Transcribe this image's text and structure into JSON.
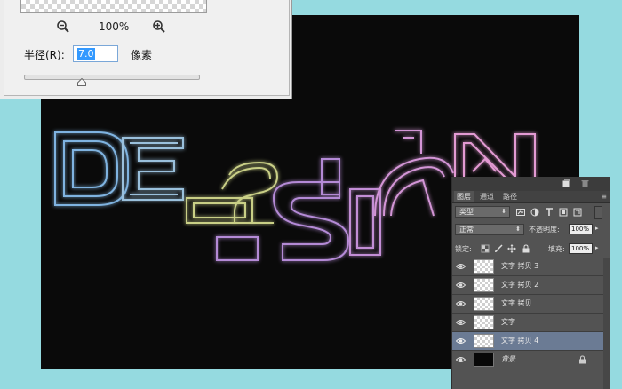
{
  "dialog": {
    "zoom_level": "100%",
    "radius_label": "半径(R):",
    "radius_value": "7.0",
    "radius_unit": "像素",
    "slider_position": 0.33
  },
  "canvas": {
    "artwork_text": "DESIGN",
    "glow_colors": [
      "#6ea6d8",
      "#c9d089",
      "#b98ad8",
      "#e39ad6"
    ]
  },
  "layers_panel": {
    "tabs": [
      {
        "label": "图层",
        "active": true
      },
      {
        "label": "通道",
        "active": false
      },
      {
        "label": "路径",
        "active": false
      }
    ],
    "panel_menu_icon": "≡",
    "filter_kind": "类型",
    "blend_mode": "正常",
    "opacity_label": "不透明度:",
    "opacity_value": "100%",
    "lock_label": "锁定:",
    "fill_label": "填充:",
    "fill_value": "100%",
    "layers": [
      {
        "name": "文字 拷贝 3",
        "visible": true,
        "selected": false,
        "thumb": "transparent"
      },
      {
        "name": "文字 拷贝 2",
        "visible": true,
        "selected": false,
        "thumb": "transparent"
      },
      {
        "name": "文字 拷贝",
        "visible": true,
        "selected": false,
        "thumb": "transparent"
      },
      {
        "name": "文字",
        "visible": true,
        "selected": false,
        "thumb": "transparent"
      },
      {
        "name": "文字 拷贝 4",
        "visible": true,
        "selected": true,
        "thumb": "transparent"
      },
      {
        "name": "背景",
        "visible": true,
        "selected": false,
        "thumb": "black",
        "locked": true
      }
    ]
  },
  "icons": [
    "zoom-out-icon",
    "zoom-in-icon",
    "eye-icon",
    "lock-icon",
    "trash-icon",
    "new-layer-icon",
    "filter-pixel-icon",
    "filter-adjustment-icon",
    "filter-type-icon",
    "filter-shape-icon",
    "filter-smart-icon",
    "lock-transparent-icon",
    "lock-brush-icon",
    "lock-move-icon"
  ]
}
